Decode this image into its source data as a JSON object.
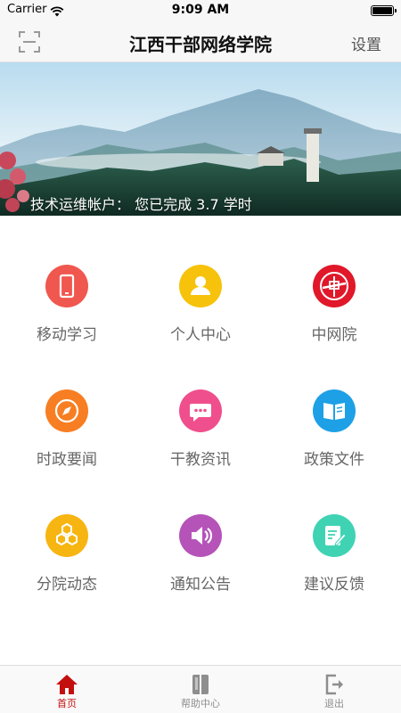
{
  "status_bar": {
    "carrier": "Carrier",
    "time": "9:09 AM"
  },
  "nav": {
    "title": "江西干部网络学院",
    "settings_label": "设置",
    "scan_icon": "scan-icon"
  },
  "banner": {
    "caption": "技术运维帐户：  您已完成 3.7 学时"
  },
  "grid": [
    {
      "label": "移动学习",
      "icon": "mobile-icon",
      "color": "#f0574e"
    },
    {
      "label": "个人中心",
      "icon": "person-icon",
      "color": "#f7c20c"
    },
    {
      "label": "中网院",
      "icon": "cnweb-icon",
      "color": "#e0182a"
    },
    {
      "label": "时政要闻",
      "icon": "compass-icon",
      "color": "#f77e22"
    },
    {
      "label": "干教资讯",
      "icon": "chat-icon",
      "color": "#ef4f8c"
    },
    {
      "label": "政策文件",
      "icon": "book-icon",
      "color": "#1ea0e6"
    },
    {
      "label": "分院动态",
      "icon": "hexagon-icon",
      "color": "#f7b512"
    },
    {
      "label": "通知公告",
      "icon": "speaker-icon",
      "color": "#b553b8"
    },
    {
      "label": "建议反馈",
      "icon": "feedback-icon",
      "color": "#3fd3b4"
    }
  ],
  "tabs": [
    {
      "label": "首页",
      "icon": "home-icon",
      "active": true
    },
    {
      "label": "帮助中心",
      "icon": "help-book-icon",
      "active": false
    },
    {
      "label": "退出",
      "icon": "logout-icon",
      "active": false
    }
  ],
  "colors": {
    "accent": "#c40f0f",
    "label_gray": "#666666"
  }
}
